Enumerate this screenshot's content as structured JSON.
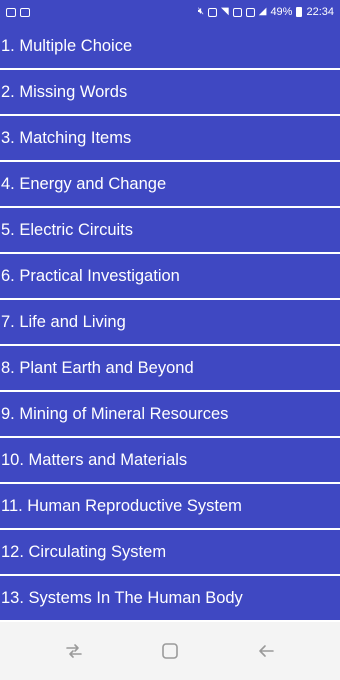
{
  "status_bar": {
    "battery_percent": "49%",
    "time": "22:34"
  },
  "list_items": [
    {
      "label": "1. Multiple Choice"
    },
    {
      "label": "2. Missing Words"
    },
    {
      "label": "3. Matching Items"
    },
    {
      "label": "4. Energy and Change"
    },
    {
      "label": "5. Electric Circuits"
    },
    {
      "label": "6. Practical Investigation"
    },
    {
      "label": "7. Life and Living"
    },
    {
      "label": "8. Plant Earth and Beyond"
    },
    {
      "label": "9. Mining of Mineral Resources"
    },
    {
      "label": "10. Matters and Materials"
    },
    {
      "label": "11. Human Reproductive System"
    },
    {
      "label": "12. Circulating System"
    },
    {
      "label": "13. Systems In The Human Body"
    }
  ],
  "nav_bar": {
    "icons": [
      "recent-apps-icon",
      "home-icon",
      "back-icon"
    ]
  },
  "colors": {
    "item_background": "#3f48c2",
    "item_text": "#ffffff",
    "nav_background": "#f4f4f4"
  }
}
